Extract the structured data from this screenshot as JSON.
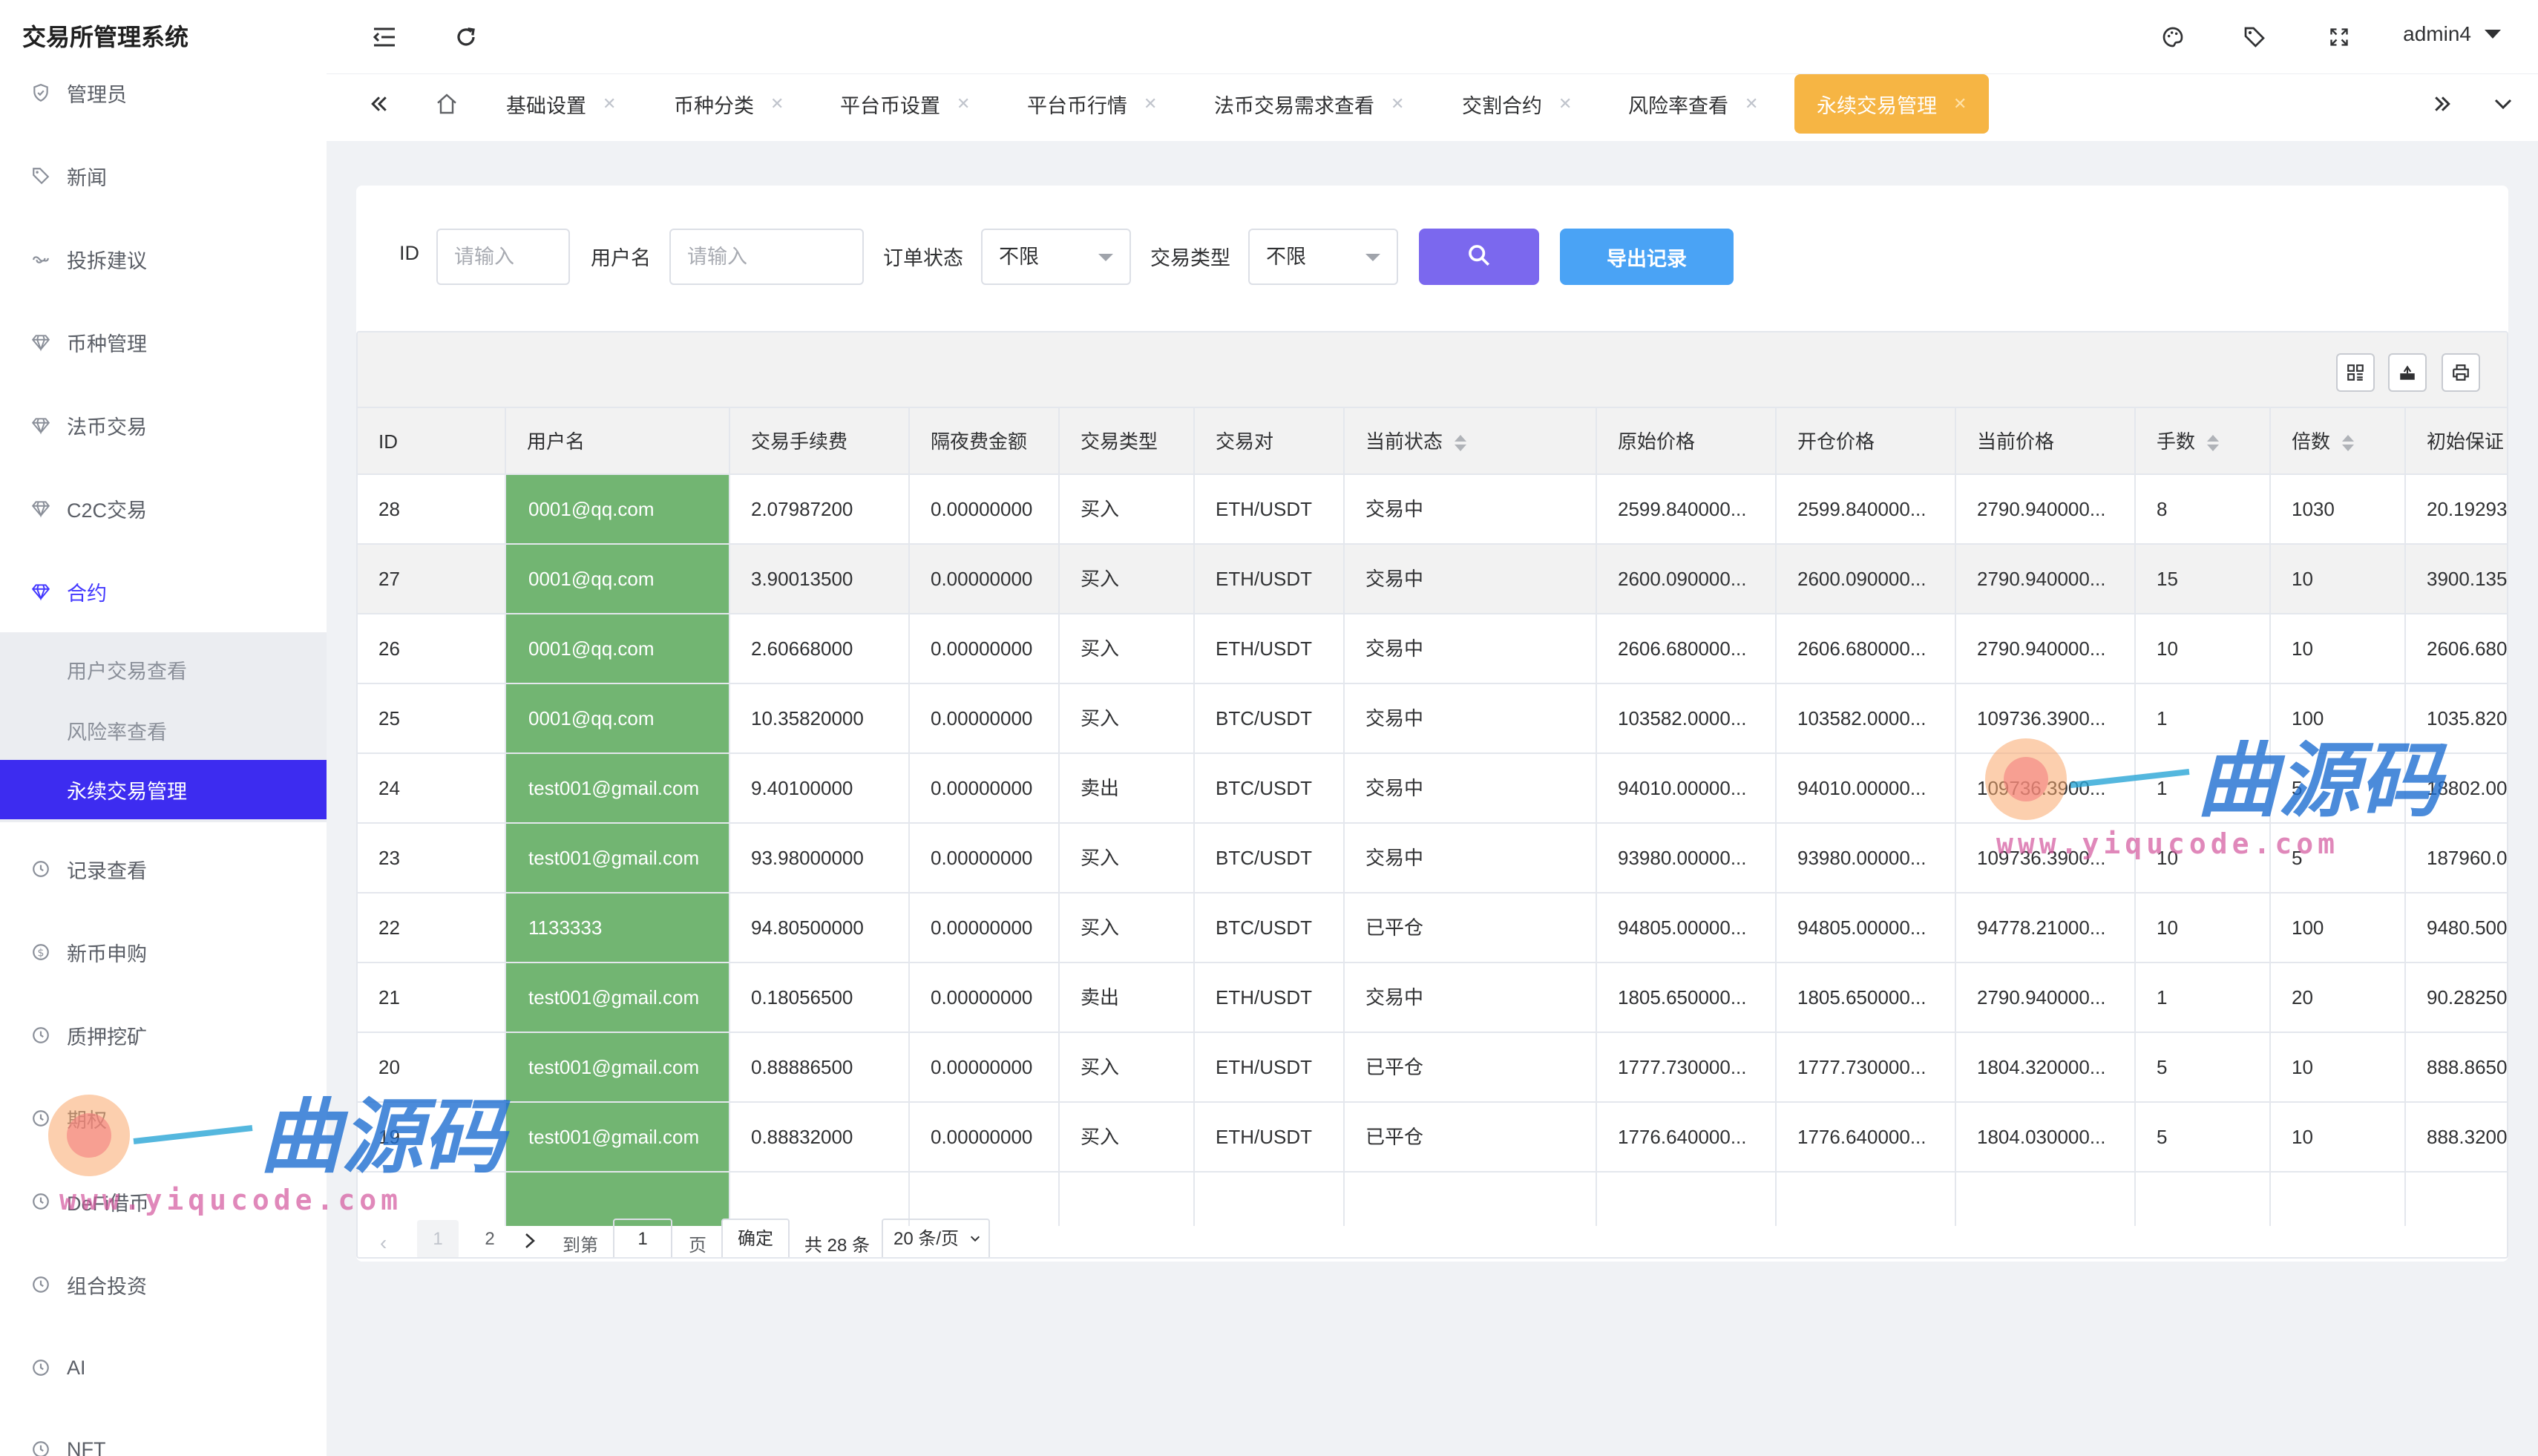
{
  "app": {
    "title": "交易所管理系统"
  },
  "sidebar": {
    "items": [
      {
        "label": "管理员",
        "icon": "shield-icon"
      },
      {
        "label": "新闻",
        "icon": "tag-icon"
      },
      {
        "label": "投拆建议",
        "icon": "link-icon"
      },
      {
        "label": "币种管理",
        "icon": "diamond-icon"
      },
      {
        "label": "法币交易",
        "icon": "diamond-icon"
      },
      {
        "label": "C2C交易",
        "icon": "diamond-icon"
      },
      {
        "label": "合约",
        "icon": "diamond-icon"
      },
      {
        "label": "记录查看",
        "icon": "clock-icon"
      },
      {
        "label": "新币申购",
        "icon": "dollar-icon"
      },
      {
        "label": "质押挖矿",
        "icon": "clock-icon"
      },
      {
        "label": "期权",
        "icon": "clock-icon"
      },
      {
        "label": "DeFi借币",
        "icon": "clock-icon"
      },
      {
        "label": "组合投资",
        "icon": "clock-icon"
      },
      {
        "label": "AI",
        "icon": "clock-icon"
      },
      {
        "label": "NFT",
        "icon": "clock-icon"
      }
    ],
    "submenu": [
      {
        "label": "用户交易查看"
      },
      {
        "label": "风险率查看"
      },
      {
        "label": "永续交易管理"
      }
    ]
  },
  "header": {
    "user": "admin4"
  },
  "tabs": [
    {
      "label": "基础设置"
    },
    {
      "label": "币种分类"
    },
    {
      "label": "平台币设置"
    },
    {
      "label": "平台币行情"
    },
    {
      "label": "法币交易需求查看"
    },
    {
      "label": "交割合约"
    },
    {
      "label": "风险率查看"
    },
    {
      "label": "永续交易管理"
    }
  ],
  "filters": {
    "id_label": "ID",
    "id_placeholder": "请输入",
    "username_label": "用户名",
    "username_placeholder": "请输入",
    "order_status_label": "订单状态",
    "order_status_value": "不限",
    "trade_type_label": "交易类型",
    "trade_type_value": "不限",
    "export_label": "导出记录"
  },
  "table": {
    "columns": [
      "ID",
      "用户名",
      "交易手续费",
      "隔夜费金额",
      "交易类型",
      "交易对",
      "当前状态",
      "原始价格",
      "开仓价格",
      "当前价格",
      "手数",
      "倍数",
      "初始保证"
    ],
    "rows": [
      [
        "28",
        "0001@qq.com",
        "2.07987200",
        "0.00000000",
        "买入",
        "ETH/USDT",
        "交易中",
        "2599.840000...",
        "2599.840000...",
        "2790.940000...",
        "8",
        "1030",
        "20.19293"
      ],
      [
        "27",
        "0001@qq.com",
        "3.90013500",
        "0.00000000",
        "买入",
        "ETH/USDT",
        "交易中",
        "2600.090000...",
        "2600.090000...",
        "2790.940000...",
        "15",
        "10",
        "3900.135"
      ],
      [
        "26",
        "0001@qq.com",
        "2.60668000",
        "0.00000000",
        "买入",
        "ETH/USDT",
        "交易中",
        "2606.680000...",
        "2606.680000...",
        "2790.940000...",
        "10",
        "10",
        "2606.680"
      ],
      [
        "25",
        "0001@qq.com",
        "10.35820000",
        "0.00000000",
        "买入",
        "BTC/USDT",
        "交易中",
        "103582.0000...",
        "103582.0000...",
        "109736.3900...",
        "1",
        "100",
        "1035.820"
      ],
      [
        "24",
        "test001@gmail.com",
        "9.40100000",
        "0.00000000",
        "卖出",
        "BTC/USDT",
        "交易中",
        "94010.00000...",
        "94010.00000...",
        "109736.3900...",
        "1",
        "5",
        "18802.00"
      ],
      [
        "23",
        "test001@gmail.com",
        "93.98000000",
        "0.00000000",
        "买入",
        "BTC/USDT",
        "交易中",
        "93980.00000...",
        "93980.00000...",
        "109736.3900...",
        "10",
        "5",
        "187960.0"
      ],
      [
        "22",
        "1133333",
        "94.80500000",
        "0.00000000",
        "买入",
        "BTC/USDT",
        "已平仓",
        "94805.00000...",
        "94805.00000...",
        "94778.21000...",
        "10",
        "100",
        "9480.500"
      ],
      [
        "21",
        "test001@gmail.com",
        "0.18056500",
        "0.00000000",
        "卖出",
        "ETH/USDT",
        "交易中",
        "1805.650000...",
        "1805.650000...",
        "2790.940000...",
        "1",
        "20",
        "90.28250"
      ],
      [
        "20",
        "test001@gmail.com",
        "0.88886500",
        "0.00000000",
        "买入",
        "ETH/USDT",
        "已平仓",
        "1777.730000...",
        "1777.730000...",
        "1804.320000...",
        "5",
        "10",
        "888.8650"
      ],
      [
        "19",
        "test001@gmail.com",
        "0.88832000",
        "0.00000000",
        "买入",
        "ETH/USDT",
        "已平仓",
        "1776.640000...",
        "1776.640000...",
        "1804.030000...",
        "5",
        "10",
        "888.3200"
      ]
    ]
  },
  "pagination": {
    "page1": "1",
    "page2": "2",
    "goto_label": "到第",
    "goto_value": "1",
    "page_unit": "页",
    "confirm": "确定",
    "total": "共 28 条",
    "page_size": "20 条/页"
  },
  "watermark": {
    "text": "曲源码",
    "url": "www.yiqucode.com"
  },
  "colors": {
    "accent": "#3d2cf0",
    "active_tab": "#f6b544",
    "search_button": "#7b68ee",
    "export_button": "#4aa3f5",
    "username_cell": "#72b572"
  }
}
